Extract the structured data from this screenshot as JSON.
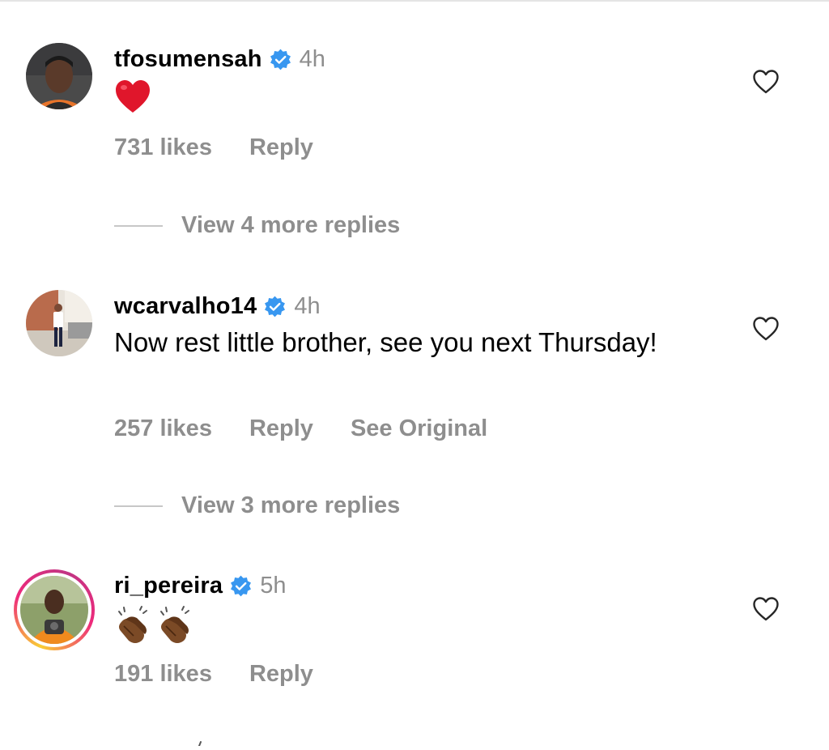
{
  "comments": [
    {
      "username": "tfosumensah",
      "time": "4h",
      "text": "",
      "emoji": [
        "heart"
      ],
      "likes": "731 likes",
      "reply": "Reply",
      "avatar": "avatar-photo",
      "verified": true
    },
    {
      "username": "wcarvalho14",
      "time": "4h",
      "text": "Now rest little brother, see you next Thursday!",
      "likes": "257 likes",
      "reply": "Reply",
      "see_original": "See Original",
      "avatar": "avatar-photo",
      "verified": true
    },
    {
      "username": "ri_pereira",
      "time": "5h",
      "text": "",
      "emoji": [
        "clapping-hands",
        "clapping-hands"
      ],
      "likes": "191 likes",
      "reply": "Reply",
      "avatar": "avatar-photo-story-ring",
      "verified": true
    }
  ],
  "view_replies": [
    "View 4 more replies",
    "View 3 more replies"
  ],
  "colors": {
    "muted_text": "#8e8e8e",
    "verified_blue": "#3897f0",
    "heart_red": "#e0162b",
    "divider": "#c7c7c7"
  },
  "icons": {
    "verified": "verified-badge-icon",
    "like": "heart-outline-icon"
  }
}
